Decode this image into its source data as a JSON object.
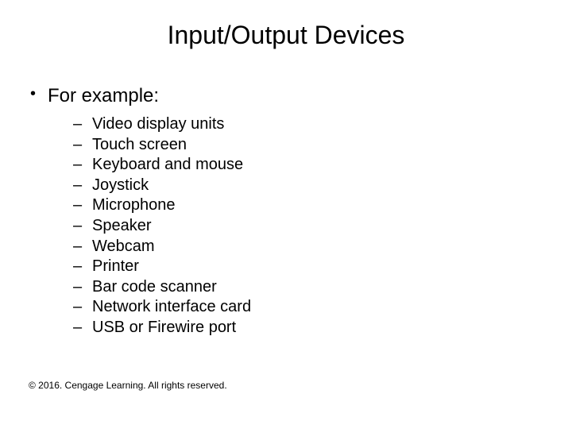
{
  "title": "Input/Output Devices",
  "lead": "For example:",
  "items": [
    "Video display units",
    "Touch screen",
    "Keyboard and mouse",
    "Joystick",
    "Microphone",
    "Speaker",
    "Webcam",
    "Printer",
    "Bar code scanner",
    "Network interface card",
    "USB or Firewire port"
  ],
  "footer": "© 2016. Cengage Learning. All rights reserved."
}
